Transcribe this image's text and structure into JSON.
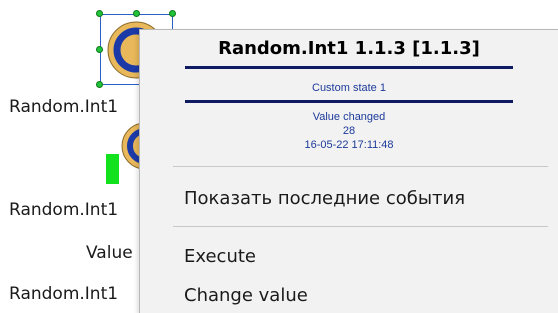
{
  "canvas": {
    "labels": {
      "label_1": "Random.Int1",
      "label_2": "Random.Int1",
      "label_3": "Value",
      "label_4": "Random.Int1"
    },
    "colors": {
      "icon_outer": "#e8b85a",
      "icon_ring": "#1b3aa8",
      "icon_inner": "#e8b85a",
      "selection_handle": "#22c23a",
      "indicator_bar": "#12e21e"
    },
    "icons": [
      "device-circle-icon",
      "device-circle-icon"
    ]
  },
  "context_menu": {
    "header": {
      "title": "Random.Int1 1.1.3 [1.1.3]",
      "state": "Custom state 1",
      "event": "Value changed",
      "value": "28",
      "timestamp": "16-05-22 17:11:48",
      "rule_color": "#0e1b62",
      "text_color": "#1d3a9a"
    },
    "items": {
      "show_events": "Показать последние события",
      "execute": "Execute",
      "change_value": "Change value"
    }
  }
}
